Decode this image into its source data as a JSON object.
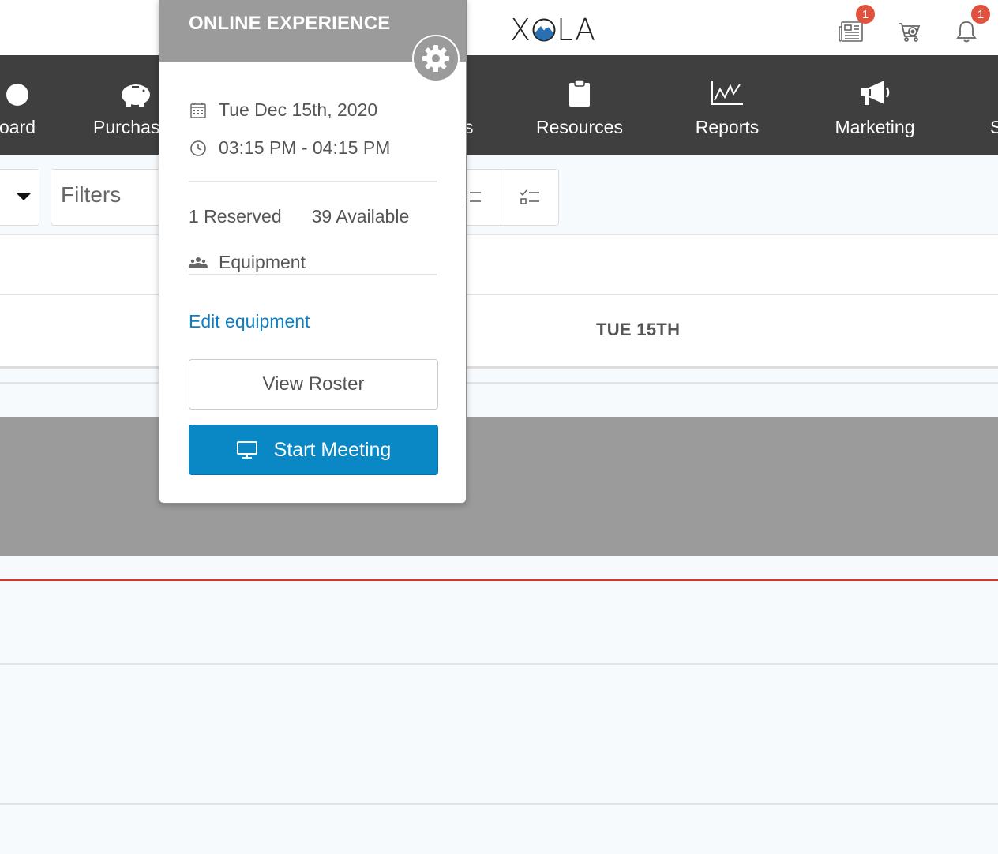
{
  "header": {
    "logo_text_left": "X",
    "logo_text_right": "LA",
    "news_badge": "1",
    "notifications_badge": "1"
  },
  "nav": {
    "items": [
      {
        "label": "oard",
        "icon": "dashboard-icon"
      },
      {
        "label": "Purchas",
        "icon": "piggy-bank-icon"
      },
      {
        "label": "s",
        "icon": "list-icon"
      },
      {
        "label": "Resources",
        "icon": "clipboard-icon"
      },
      {
        "label": "Reports",
        "icon": "line-chart-icon"
      },
      {
        "label": "Marketing",
        "icon": "megaphone-icon"
      },
      {
        "label": "S",
        "icon": "settings-icon"
      }
    ]
  },
  "toolbar": {
    "filters_label": "Filters"
  },
  "calendar": {
    "day_header": "TUE 15TH"
  },
  "popover": {
    "title": "ONLINE EXPERIENCE",
    "date": "Tue Dec 15th, 2020",
    "time": "03:15 PM - 04:15 PM",
    "reserved": "1 Reserved",
    "available": "39 Available",
    "equipment_label": "Equipment",
    "edit_equipment_link": "Edit equipment",
    "view_roster_button": "View Roster",
    "start_meeting_button": "Start Meeting"
  },
  "colors": {
    "navbar": "#3f3f3f",
    "popover_header": "#9b9b9b",
    "primary_button": "#0a88c6",
    "link": "#0f7fc4",
    "badge": "#e0523e",
    "now_line": "#d9342b"
  }
}
